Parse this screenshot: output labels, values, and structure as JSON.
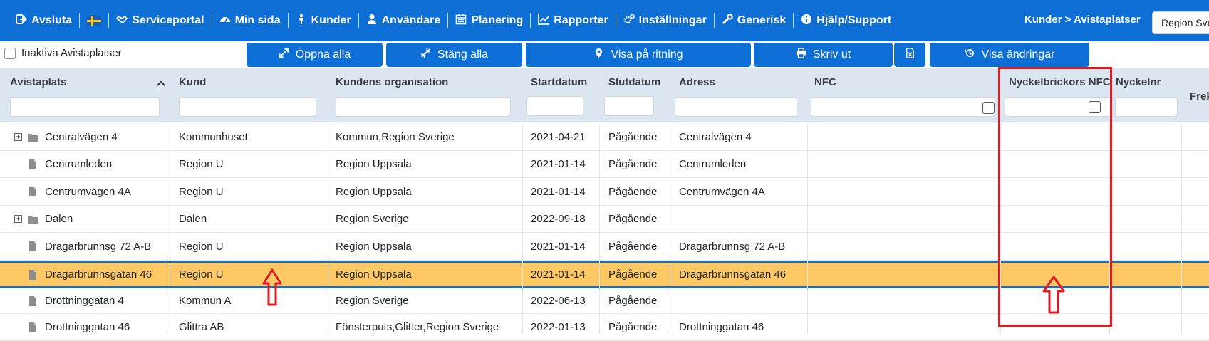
{
  "navbar": {
    "items": [
      {
        "label": "Avsluta",
        "icon": "sign-out-icon"
      },
      {
        "label": "",
        "icon": "swedish-flag-icon"
      },
      {
        "label": "Serviceportal",
        "icon": "handshake-icon"
      },
      {
        "label": "Min sida",
        "icon": "dashboard-icon"
      },
      {
        "label": "Kunder",
        "icon": "person-icon"
      },
      {
        "label": "Användare",
        "icon": "user-icon"
      },
      {
        "label": "Planering",
        "icon": "calendar-icon"
      },
      {
        "label": "Rapporter",
        "icon": "chart-icon"
      },
      {
        "label": "Inställningar",
        "icon": "gears-icon"
      },
      {
        "label": "Generisk",
        "icon": "wrench-icon"
      },
      {
        "label": "Hjälp/Support",
        "icon": "info-icon"
      }
    ],
    "breadcrumb": "Kunder > Avistaplatser",
    "region_select": "Region Sve",
    "color": "#0d6fd6"
  },
  "toolbar": {
    "inactive_label": "Inaktiva Avistaplatser",
    "buttons": {
      "open_all": "Öppna alla",
      "close_all": "Stäng alla",
      "show_on_drawing": "Visa på ritning",
      "print": "Skriv ut",
      "excel": "excel-icon",
      "show_changes": "Visa ändringar"
    }
  },
  "grid": {
    "columns": [
      "Avistaplats",
      "Kund",
      "Kundens organisation",
      "Startdatum",
      "Slutdatum",
      "Adress",
      "NFC",
      "Nyckelbrickors NFC",
      "Nyckelnr",
      "Frek"
    ],
    "rows": [
      {
        "type": "folder",
        "expandable": true,
        "place": "Centralvägen 4",
        "customer": "Kommunhuset",
        "org": "Kommun,Region Sverige",
        "start": "2021-04-21",
        "end": "Pågående",
        "address": "Centralvägen 4"
      },
      {
        "type": "file",
        "expandable": false,
        "place": "Centrumleden",
        "customer": "Region U",
        "org": "Region Uppsala",
        "start": "2021-01-14",
        "end": "Pågående",
        "address": "Centrumleden"
      },
      {
        "type": "file",
        "expandable": false,
        "place": "Centrumvägen 4A",
        "customer": "Region U",
        "org": "Region Uppsala",
        "start": "2021-01-14",
        "end": "Pågående",
        "address": "Centrumvägen 4A"
      },
      {
        "type": "folder",
        "expandable": true,
        "place": "Dalen",
        "customer": "Dalen",
        "org": "Region Sverige",
        "start": "2022-09-18",
        "end": "Pågående",
        "address": ""
      },
      {
        "type": "file",
        "expandable": false,
        "place": "Dragarbrunnsg 72 A-B",
        "customer": "Region U",
        "org": "Region Uppsala",
        "start": "2021-01-14",
        "end": "Pågående",
        "address": "Dragarbrunnsg 72 A-B"
      },
      {
        "type": "file",
        "expandable": false,
        "selected": true,
        "place": "Dragarbrunnsgatan 46",
        "customer": "Region U",
        "org": "Region Uppsala",
        "start": "2021-01-14",
        "end": "Pågående",
        "address": "Dragarbrunnsgatan 46"
      },
      {
        "type": "file",
        "expandable": false,
        "place": "Drottninggatan 4",
        "customer": "Kommun A",
        "org": "Region Sverige",
        "start": "2022-06-13",
        "end": "Pågående",
        "address": ""
      },
      {
        "type": "file",
        "expandable": false,
        "place": "Drottninggatan 46",
        "customer": "Glittra AB",
        "org": "Fönsterputs,Glitter,Region Sverige",
        "start": "2022-01-13",
        "end": "Pågående",
        "address": "Drottninggatan 46"
      }
    ],
    "selected_color": "#fec965",
    "header_color": "#dce6f0"
  }
}
